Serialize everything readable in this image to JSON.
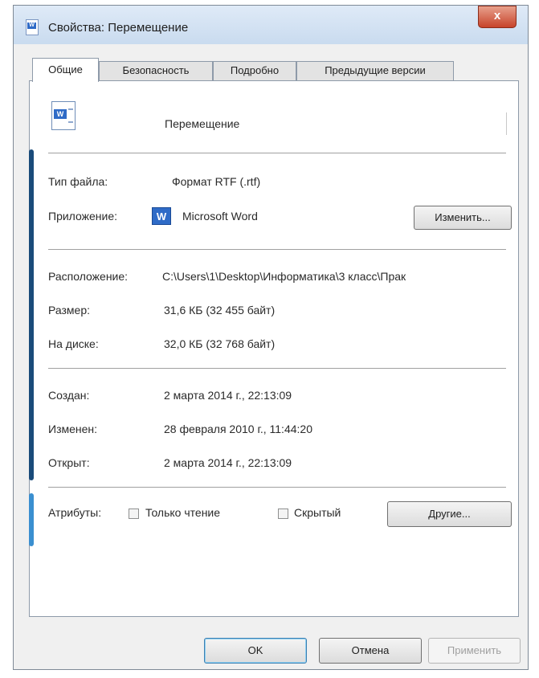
{
  "window": {
    "title": "Свойства: Перемещение",
    "close_label": "x"
  },
  "tabs": [
    {
      "label": "Общие",
      "active": true
    },
    {
      "label": "Безопасность",
      "active": false
    },
    {
      "label": "Подробно",
      "active": false
    },
    {
      "label": "Предыдущие версии",
      "active": false
    }
  ],
  "general": {
    "file_name": "Перемещение",
    "file_type_label": "Тип файла:",
    "file_type_value": "Формат RTF (.rtf)",
    "opens_with_label": "Приложение:",
    "opens_with_value": "Microsoft Word",
    "change_button": "Изменить...",
    "location_label": "Расположение:",
    "location_value": "C:\\Users\\1\\Desktop\\Информатика\\3 класс\\Прак",
    "size_label": "Размер:",
    "size_value": "31,6 КБ (32 455 байт)",
    "size_on_disk_label": "На диске:",
    "size_on_disk_value": "32,0 КБ (32 768 байт)",
    "created_label": "Создан:",
    "created_value": "2 марта 2014 г., 22:13:09",
    "modified_label": "Изменен:",
    "modified_value": "28 февраля 2010 г., 11:44:20",
    "accessed_label": "Открыт:",
    "accessed_value": "2 марта 2014 г., 22:13:09",
    "attributes_label": "Атрибуты:",
    "readonly_label": "Только чтение",
    "readonly_checked": false,
    "hidden_label": "Скрытый",
    "hidden_checked": false,
    "other_button": "Другие..."
  },
  "footer": {
    "ok_button": "OK",
    "cancel_button": "Отмена",
    "apply_button": "Применить"
  },
  "icons": {
    "word_badge": "W"
  }
}
